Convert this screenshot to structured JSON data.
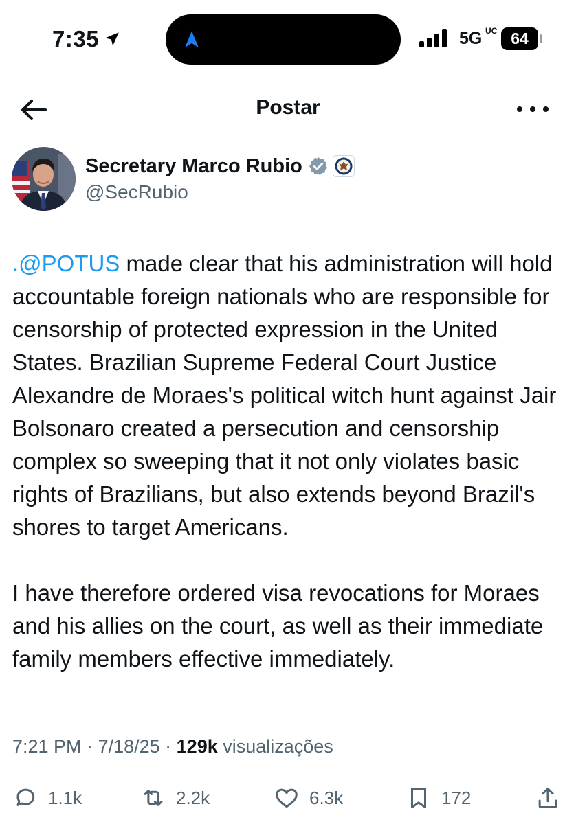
{
  "status_bar": {
    "time": "7:35",
    "network": "5G",
    "network_sub": "UC",
    "battery": "64"
  },
  "header": {
    "title": "Postar"
  },
  "author": {
    "name": "Secretary Marco Rubio",
    "handle": "@SecRubio"
  },
  "tweet": {
    "mention": ".@POTUS",
    "paragraph1_rest": " made clear that his administration will hold accountable foreign nationals who are responsible for censorship of protected expression in the United States. Brazilian Supreme Federal Court Justice Alexandre de Moraes's political witch hunt against Jair Bolsonaro created a persecution and censorship complex so sweeping that it not only violates basic rights of Brazilians, but also extends beyond Brazil's shores to target Americans.",
    "paragraph2": "I have therefore ordered visa revocations for Moraes and his allies on the court, as well as their immediate family members effective immediately."
  },
  "meta": {
    "time": "7:21 PM",
    "sep1": " · ",
    "date": "7/18/25",
    "sep2": " · ",
    "views": "129k",
    "views_label": " visualizações"
  },
  "actions": {
    "replies": "1.1k",
    "reposts": "2.2k",
    "likes": "6.3k",
    "bookmarks": "172"
  },
  "colors": {
    "link": "#1d9bf0",
    "secondary_text": "#536471",
    "primary_text": "#0f1419",
    "verified_badge": "#829aab",
    "battery_bg": "#000000"
  },
  "icons": [
    "location-arrow-icon",
    "back-arrow-icon",
    "more-icon",
    "verified-badge-icon",
    "state-department-seal-icon",
    "reply-icon",
    "repost-icon",
    "like-icon",
    "bookmark-icon",
    "share-icon"
  ]
}
